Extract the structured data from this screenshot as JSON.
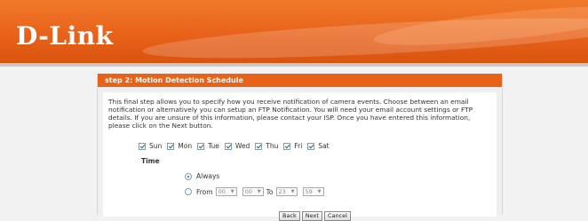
{
  "brand": {
    "logo_text": "D-Link",
    "accent_color": "#e8621a"
  },
  "panel": {
    "title": "step 2: Motion Detection Schedule",
    "description": "This final step allows you to specify how you receive notification of camera events. Choose between an email notification or alternatively you can setup an FTP Notification. You will need your email account settings or FTP details. If you are unsure of this information, please contact your ISP. Once you have entered this information, please click on the Next button."
  },
  "days": [
    {
      "label": "Sun",
      "checked": true
    },
    {
      "label": "Mon",
      "checked": true
    },
    {
      "label": "Tue",
      "checked": true
    },
    {
      "label": "Wed",
      "checked": true
    },
    {
      "label": "Thu",
      "checked": true
    },
    {
      "label": "Fri",
      "checked": true
    },
    {
      "label": "Sat",
      "checked": true
    }
  ],
  "time": {
    "label": "Time",
    "always_label": "Always",
    "always_selected": true,
    "from_label": "From",
    "to_label": "To",
    "from_hour": "00",
    "from_minute": "00",
    "to_hour": "23",
    "to_minute": "59"
  },
  "buttons": {
    "back": "Back",
    "next": "Next",
    "cancel": "Cancel"
  }
}
